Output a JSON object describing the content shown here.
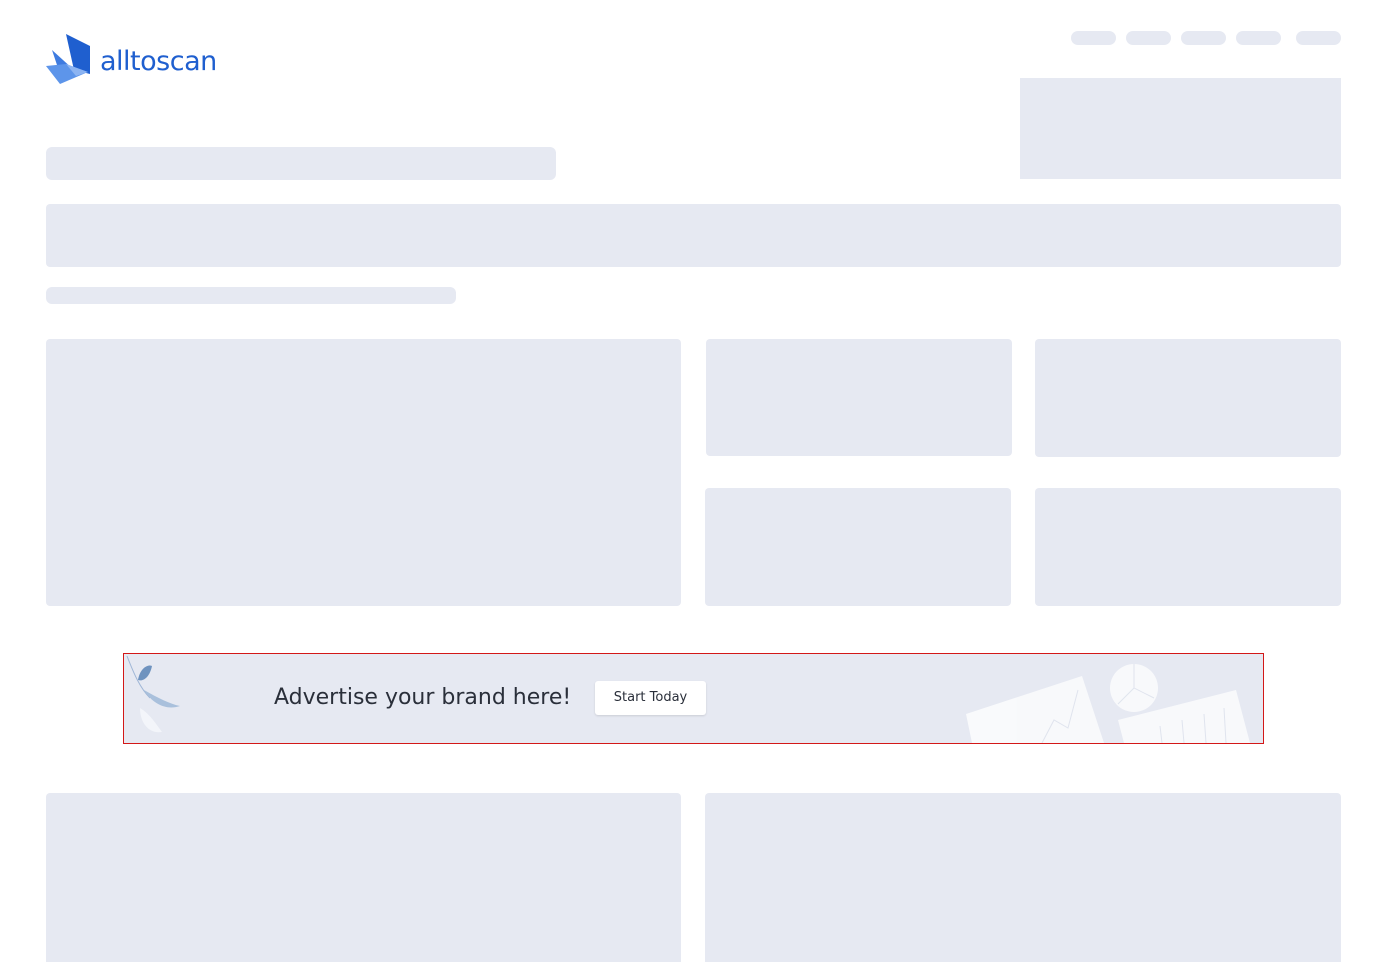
{
  "header": {
    "logo_text": "alltoscan",
    "brand_color": "#1f5fcf"
  },
  "ad_banner": {
    "headline": "Advertise your brand here!",
    "cta_label": "Start Today",
    "border_color": "#d31818"
  },
  "skeleton": {
    "placeholder_color": "#e6e9f2",
    "state": "loading"
  }
}
